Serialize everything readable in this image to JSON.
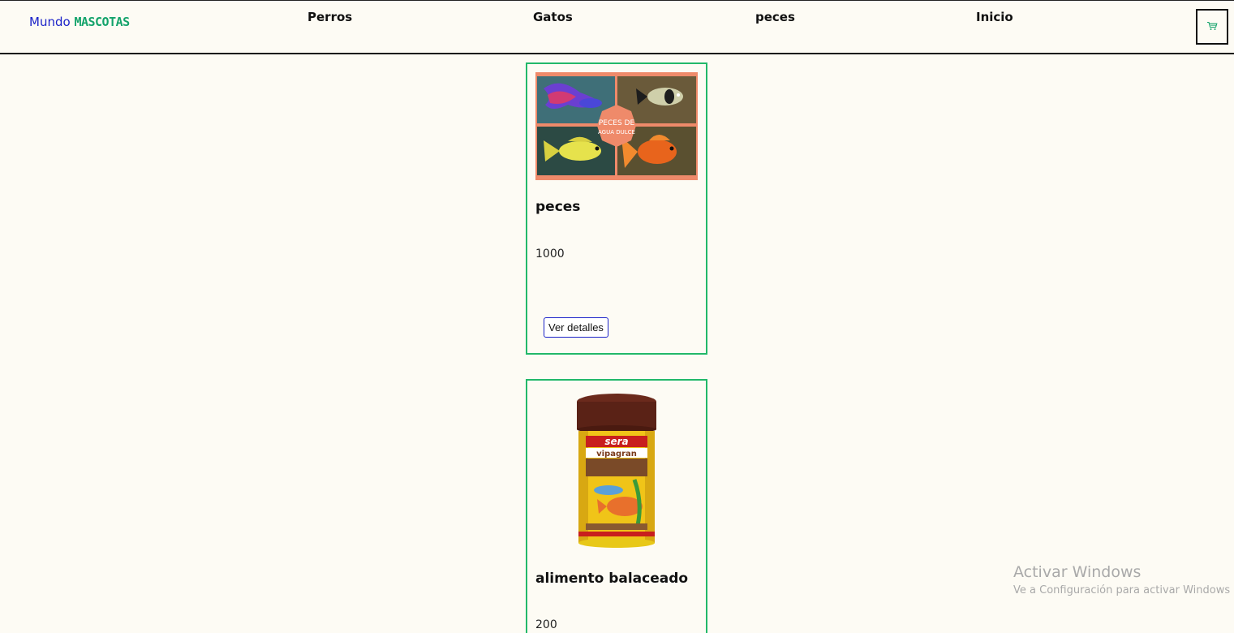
{
  "brand": {
    "part1": "Mundo",
    "part2": "MASCOTAS"
  },
  "nav": {
    "links": [
      "Perros",
      "Gatos",
      "peces",
      "Inicio"
    ],
    "cart_icon": "cart-icon"
  },
  "products": [
    {
      "image_icon": "fish-collage-image",
      "image_text_line1": "PECES DE",
      "image_text_line2": "AGUA DULCE",
      "title": "peces",
      "price": "1000",
      "button_label": "Ver detalles"
    },
    {
      "image_icon": "fish-food-can-image",
      "image_brand": "sera",
      "image_product": "vipagran",
      "title": "alimento balaceado",
      "price": "200"
    }
  ],
  "watermark": {
    "line1": "Activar Windows",
    "line2": "Ve a Configuración para activar Windows"
  },
  "colors": {
    "background": "#fdfbf4",
    "brand_blue": "#1b22c9",
    "brand_green": "#14a36b",
    "card_border": "#22b86a"
  }
}
